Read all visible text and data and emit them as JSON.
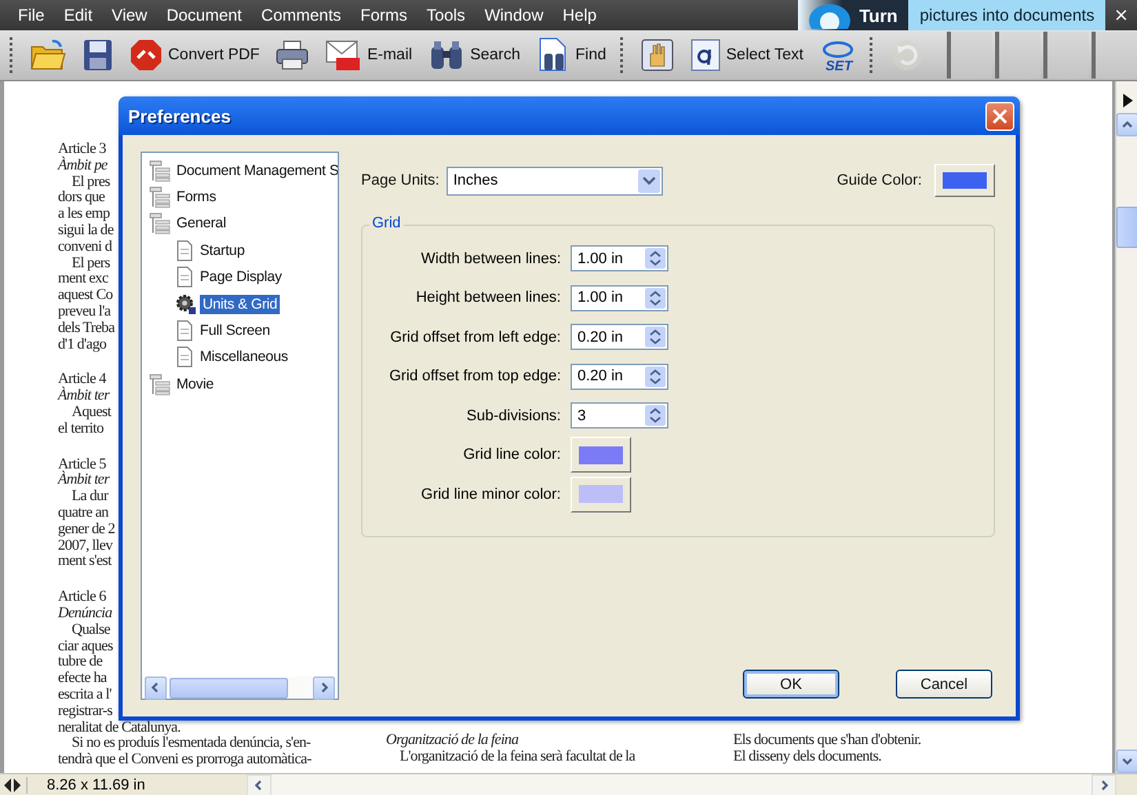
{
  "menu": [
    "File",
    "Edit",
    "View",
    "Document",
    "Comments",
    "Forms",
    "Tools",
    "Window",
    "Help"
  ],
  "banner": {
    "brand": "Turn",
    "tagline": "pictures into documents",
    "close": "×"
  },
  "toolbar": [
    {
      "kind": "open",
      "disabled": false
    },
    {
      "kind": "save",
      "disabled": false
    },
    {
      "kind": "convert",
      "label": "Convert PDF",
      "disabled": false
    },
    {
      "kind": "print",
      "disabled": false
    },
    {
      "kind": "email",
      "label": "E-mail",
      "disabled": false
    },
    {
      "kind": "search",
      "label": "Search",
      "disabled": false
    },
    {
      "kind": "find",
      "label": "Find",
      "disabled": false
    },
    {
      "kind": "hand",
      "disabled": false
    },
    {
      "kind": "select",
      "label": "Select Text",
      "disabled": false
    },
    {
      "kind": "set",
      "disabled": false
    },
    {
      "kind": "undo",
      "disabled": true
    }
  ],
  "set_icon_text": "SET",
  "document": {
    "columns": [
      {
        "articles": [
          {
            "lines": [
              {
                "kind": "heading",
                "text": "Article 3"
              },
              {
                "kind": "subheading",
                "text": "Àmbit pe"
              },
              {
                "kind": "indent",
                "text": "El pres"
              },
              {
                "kind": "text",
                "text": "dors que"
              },
              {
                "kind": "text",
                "text": "a les emp"
              },
              {
                "kind": "text",
                "text": "sigui la de"
              },
              {
                "kind": "text",
                "text": "conveni d"
              },
              {
                "kind": "indent",
                "text": "El pers"
              },
              {
                "kind": "text",
                "text": "ment exc"
              },
              {
                "kind": "text",
                "text": "aquest Co"
              },
              {
                "kind": "text",
                "text": "preveu l'a"
              },
              {
                "kind": "text",
                "text": "dels Treba"
              },
              {
                "kind": "text",
                "text": "d'1 d'ago"
              }
            ]
          },
          {
            "lines": [
              {
                "kind": "heading",
                "text": "Article 4"
              },
              {
                "kind": "subheading",
                "text": "Àmbit ter"
              },
              {
                "kind": "indent",
                "text": "Aquest"
              },
              {
                "kind": "text",
                "text": "el territo"
              }
            ]
          },
          {
            "lines": [
              {
                "kind": "heading",
                "text": "Article 5"
              },
              {
                "kind": "subheading",
                "text": "Àmbit ter"
              },
              {
                "kind": "indent",
                "text": "La dur"
              },
              {
                "kind": "text",
                "text": "quatre an"
              },
              {
                "kind": "text",
                "text": "gener de 2"
              },
              {
                "kind": "text",
                "text": "2007, llev"
              },
              {
                "kind": "text",
                "text": "ment s'est"
              }
            ]
          },
          {
            "lines": [
              {
                "kind": "heading",
                "text": "Article 6"
              },
              {
                "kind": "subheading",
                "text": "Denúncia"
              },
              {
                "kind": "indent",
                "text": "Qualse"
              },
              {
                "kind": "text",
                "text": "ciar aques"
              },
              {
                "kind": "text",
                "text": "tubre de"
              },
              {
                "kind": "text",
                "text": "efecte ha"
              },
              {
                "kind": "text",
                "text": "escrita a l'"
              },
              {
                "kind": "text",
                "text": "registrar-s"
              },
              {
                "kind": "text",
                "text": "neralitat de Catalunya."
              },
              {
                "kind": "indent",
                "text": "Si no es produís l'esmentada denúncia, s'en-"
              },
              {
                "kind": "text",
                "text": "tendrà que el Conveni es prorroga automàtica-"
              }
            ]
          }
        ]
      },
      {
        "articles": [
          {
            "lines": [
              {
                "kind": "subheading",
                "text": "Organització de la feina"
              },
              {
                "kind": "indent",
                "text": "L'organització de la feina serà facultat de la"
              }
            ]
          }
        ]
      },
      {
        "articles": [
          {
            "lines": [
              {
                "kind": "text",
                "text": "Els documents que s'han d'obtenir."
              },
              {
                "kind": "text",
                "text": "El disseny dels documents."
              }
            ]
          }
        ]
      }
    ]
  },
  "status_bar": {
    "page_size": "8.26 x 11.69 in"
  },
  "dialog": {
    "title": "Preferences",
    "tree": [
      {
        "kind": "group",
        "label": "Document Management S",
        "selected": false
      },
      {
        "kind": "group",
        "label": "Forms",
        "selected": false
      },
      {
        "kind": "group",
        "label": "General",
        "selected": false,
        "children": [
          {
            "kind": "page",
            "label": "Startup",
            "selected": false
          },
          {
            "kind": "page",
            "label": "Page Display",
            "selected": false
          },
          {
            "kind": "settings",
            "label": "Units & Grid",
            "selected": true
          },
          {
            "kind": "page",
            "label": "Full Screen",
            "selected": false
          },
          {
            "kind": "page",
            "label": "Miscellaneous",
            "selected": false
          }
        ]
      },
      {
        "kind": "group",
        "label": "Movie",
        "selected": false
      }
    ],
    "page_units": {
      "label": "Page Units:",
      "value": "Inches"
    },
    "guide_color": {
      "label": "Guide Color:",
      "color": "#3d62f2"
    },
    "grid": {
      "title": "Grid",
      "fields": [
        {
          "kind": "spin",
          "label": "Width between lines:",
          "value": "1.00 in"
        },
        {
          "kind": "spin",
          "label": "Height between lines:",
          "value": "1.00 in"
        },
        {
          "kind": "spin",
          "label": "Grid offset from left edge:",
          "value": "0.20 in"
        },
        {
          "kind": "spin",
          "label": "Grid offset from top edge:",
          "value": "0.20 in"
        },
        {
          "kind": "spin",
          "label": "Sub-divisions:",
          "value": "3"
        },
        {
          "kind": "color",
          "label": "Grid line color:",
          "color": "#7c7bf6"
        },
        {
          "kind": "color",
          "label": "Grid line minor color:",
          "color": "#bdbdf7"
        }
      ]
    },
    "buttons": [
      "OK",
      "Cancel"
    ]
  }
}
